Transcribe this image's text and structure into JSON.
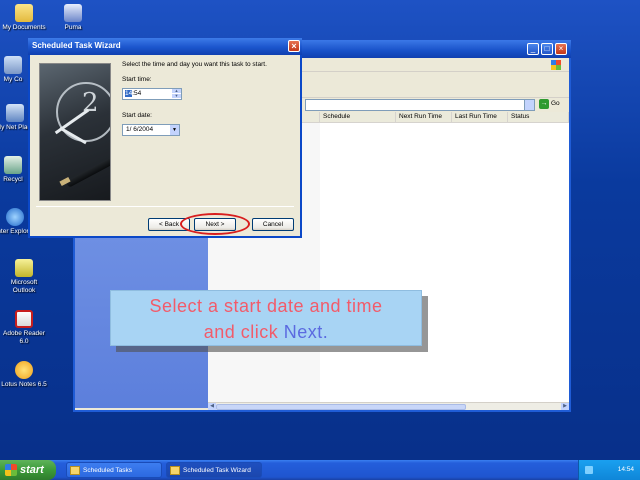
{
  "desktop_icons": [
    {
      "label": "My Documents"
    },
    {
      "label": "Puma"
    },
    {
      "label": "My Co"
    },
    {
      "label": "My Net Place"
    },
    {
      "label": "Recycl"
    },
    {
      "label": "Inter Explorer"
    },
    {
      "label": "Microsoft Outlook"
    },
    {
      "label": "Adobe Reader 6.0"
    },
    {
      "label": "Lotus Notes 6.5"
    }
  ],
  "explorer": {
    "go_label": "Go",
    "columns": [
      "Schedule",
      "Next Run Time",
      "Last Run Time",
      "Status"
    ]
  },
  "wizard": {
    "title": "Scheduled Task Wizard",
    "instruction": "Select the time and day you want this task to start.",
    "start_time_label": "Start time:",
    "start_time_hour": "14",
    "start_time_min": ":54",
    "start_date_label": "Start date:",
    "start_date_value": "1/ 6/2004",
    "back_label": "< Back",
    "next_label": "Next >",
    "cancel_label": "Cancel"
  },
  "callout": {
    "line1": "Select a start date and time",
    "line2_prefix": "and click ",
    "line2_highlight": "Next."
  },
  "taskbar": {
    "start_label": "start",
    "tasks": [
      "Scheduled Tasks",
      "Scheduled Task Wizard"
    ],
    "language": "EN",
    "clock": "14:54"
  }
}
